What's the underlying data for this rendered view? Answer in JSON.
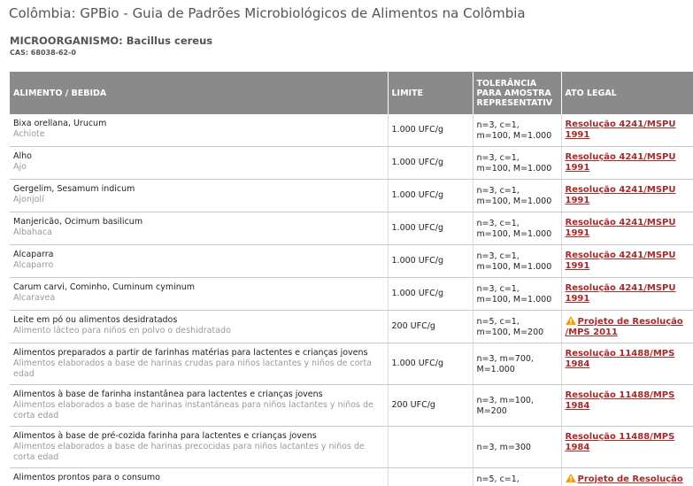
{
  "page_title": "Colômbia: GPBio - Guia de Padrões Microbiológicos de Alimentos na Colômbia",
  "microorganism_label": "MICROORGANISMO:",
  "microorganism_name": "Bacillus cereus",
  "cas": "CAS: 68038-62-0",
  "columns": {
    "food": "ALIMENTO / BEBIDA",
    "limit": "LIMITE",
    "tolerance_1": "TOLERÂNCIA",
    "tolerance_2": "PARA AMOSTRA",
    "tolerance_3": "REPRESENTATIV",
    "legal": "ATO LEGAL"
  },
  "rows": [
    {
      "name": "Bixa orellana, Urucum",
      "subname": "Achiote",
      "limit": "1.000 UFC/g",
      "tol1": "n=3, c=1,",
      "tol2": "m=100, M=1.000",
      "legal1": "Resolução 4241/MSPU",
      "legal2": "1991",
      "warn": false
    },
    {
      "name": "Alho",
      "subname": "Ajo",
      "limit": "1.000 UFC/g",
      "tol1": "n=3, c=1,",
      "tol2": "m=100, M=1.000",
      "legal1": "Resolução 4241/MSPU",
      "legal2": "1991",
      "warn": false
    },
    {
      "name": "Gergelim, Sesamum indicum",
      "subname": "Ajonjolí",
      "limit": "1.000 UFC/g",
      "tol1": "n=3, c=1,",
      "tol2": "m=100, M=1.000",
      "legal1": "Resolução 4241/MSPU",
      "legal2": "1991",
      "warn": false
    },
    {
      "name": "Manjericão, Ocimum basilicum",
      "subname": "Albahaca",
      "limit": "1.000 UFC/g",
      "tol1": "n=3, c=1,",
      "tol2": "m=100, M=1.000",
      "legal1": "Resolução 4241/MSPU",
      "legal2": "1991",
      "warn": false
    },
    {
      "name": "Alcaparra",
      "subname": "Alcaparro",
      "limit": "1.000 UFC/g",
      "tol1": "n=3, c=1,",
      "tol2": "m=100, M=1.000",
      "legal1": "Resolução 4241/MSPU",
      "legal2": "1991",
      "warn": false
    },
    {
      "name": "Carum carvi, Cominho, Cuminum cyminum",
      "subname": "Alcaravea",
      "limit": "1.000 UFC/g",
      "tol1": "n=3, c=1,",
      "tol2": "m=100, M=1.000",
      "legal1": "Resolução 4241/MSPU",
      "legal2": "1991",
      "warn": false
    },
    {
      "name": "Leite em pó ou alimentos desidratados",
      "subname": "Alimento lácteo para niños en polvo o deshidratado",
      "limit": "200 UFC/g",
      "tol1": "n=5, c=1,",
      "tol2": "m=100, M=200",
      "legal1": "Projeto de Resolução",
      "legal2": "/MPS 2011",
      "warn": true
    },
    {
      "name": "Alimentos preparados a partir de farinhas matérias para lactentes e crianças jovens",
      "subname": "Alimentos elaborados a base de harinas crudas para niños lactantes y niños de corta edad",
      "limit": "1.000 UFC/g",
      "tol1": "n=3, m=700,",
      "tol2": "M=1.000",
      "legal1": "Resolução 11488/MPS",
      "legal2": "1984",
      "warn": false
    },
    {
      "name": "Alimentos à base de farinha instantânea para lactentes e crianças jovens",
      "subname": "Alimentos elaborados a base de harinas instantáneas para niños lactantes y niños de corta edad",
      "limit": "200 UFC/g",
      "tol1": "n=3, m=100,",
      "tol2": "M=200",
      "legal1": "Resolução 11488/MPS",
      "legal2": "1984",
      "warn": false
    },
    {
      "name": "Alimentos à base de pré-cozida farinha para lactentes e crianças jovens",
      "subname": "Alimentos elaborados a base de harinas precocidas para niños lactantes y niños de corta edad",
      "limit": "",
      "tol1": "n=3, m=300",
      "tol2": "",
      "legal1": "Resolução 11488/MPS",
      "legal2": "1984",
      "warn": false
    },
    {
      "name": "Alimentos prontos para o consumo",
      "subname": "",
      "limit": "",
      "tol1": "n=5, c=1,",
      "tol2": "",
      "legal1": "Projeto de Resolução",
      "legal2": "",
      "warn": true
    }
  ]
}
